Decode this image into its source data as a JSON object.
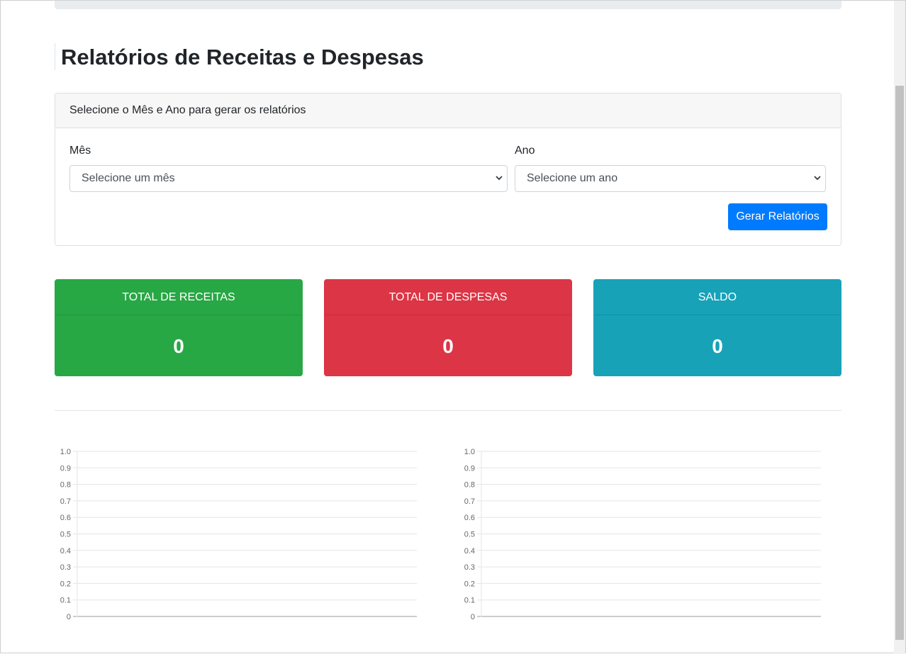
{
  "page": {
    "title": "Relatórios de Receitas e Despesas"
  },
  "form": {
    "header": "Selecione o Mês e Ano para gerar os relatórios",
    "month_label": "Mês",
    "month_value": "Selecione um mês",
    "year_label": "Ano",
    "year_value": "Selecione um ano",
    "submit_label": "Gerar Relatórios"
  },
  "stats": [
    {
      "label": "TOTAL DE RECEITAS",
      "value": "0",
      "color": "#28a745"
    },
    {
      "label": "TOTAL DE DESPESAS",
      "value": "0",
      "color": "#dc3545"
    },
    {
      "label": "SALDO",
      "value": "0",
      "color": "#17a2b8"
    }
  ],
  "colors": {
    "primary": "#007bff",
    "success": "#28a745",
    "danger": "#dc3545",
    "info": "#17a2b8"
  },
  "chart_data": [
    {
      "type": "bar",
      "categories": [],
      "values": [],
      "title": "",
      "xlabel": "",
      "ylabel": "",
      "ylim": [
        0,
        1.0
      ],
      "yticks": [
        "0",
        "0.1",
        "0.2",
        "0.3",
        "0.4",
        "0.5",
        "0.6",
        "0.7",
        "0.8",
        "0.9",
        "1.0"
      ],
      "grid": true
    },
    {
      "type": "bar",
      "categories": [],
      "values": [],
      "title": "",
      "xlabel": "",
      "ylabel": "",
      "ylim": [
        0,
        1.0
      ],
      "yticks": [
        "0",
        "0.1",
        "0.2",
        "0.3",
        "0.4",
        "0.5",
        "0.6",
        "0.7",
        "0.8",
        "0.9",
        "1.0"
      ],
      "grid": true
    }
  ]
}
